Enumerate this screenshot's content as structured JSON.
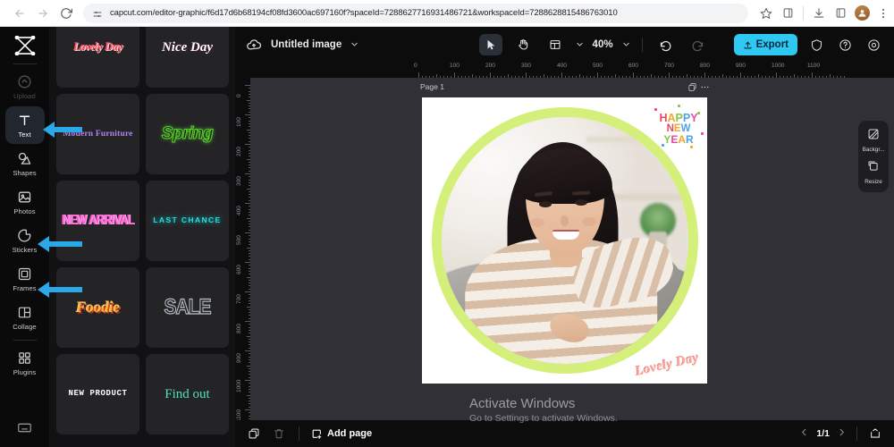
{
  "browser": {
    "back_icon": "back-arrow-icon",
    "forward_icon": "forward-arrow-icon",
    "reload_icon": "reload-icon",
    "url": "capcut.com/editor-graphic/f6d17d6b68194cf08fd3600ac697160f?spaceId=7288627716931486721&workspaceId=7288628815486763010",
    "bookmark_icon": "star-icon",
    "sidepanel_icon": "side-panel-icon",
    "download_icon": "download-icon",
    "extensions_icon": "extensions-icon",
    "profile_icon": "profile-avatar-icon",
    "menu_icon": "three-dot-menu-icon"
  },
  "rail": {
    "logo": "capcut-logo-icon",
    "items": [
      {
        "label": "Upload",
        "icon": "upload-icon",
        "state": "dim"
      },
      {
        "label": "Text",
        "icon": "text-icon",
        "state": "active"
      },
      {
        "label": "Shapes",
        "icon": "shapes-icon",
        "state": "normal"
      },
      {
        "label": "Photos",
        "icon": "photos-icon",
        "state": "normal"
      },
      {
        "label": "Stickers",
        "icon": "stickers-icon",
        "state": "normal"
      },
      {
        "label": "Frames",
        "icon": "frames-icon",
        "state": "normal"
      },
      {
        "label": "Collage",
        "icon": "collage-icon",
        "state": "normal"
      },
      {
        "label": "Plugins",
        "icon": "plugins-icon",
        "state": "normal"
      }
    ],
    "bottom_icon": "keyboard-icon"
  },
  "templates": [
    {
      "text": "Lovely Day",
      "style": "st-lovely"
    },
    {
      "text": "Nice Day",
      "style": "st-nice"
    },
    {
      "text": "Modern Furniture",
      "style": "st-modern"
    },
    {
      "text": "Spring",
      "style": "st-spring"
    },
    {
      "text": "NEW ARRIVAL",
      "style": "st-newarrival"
    },
    {
      "text": "LAST CHANCE",
      "style": "st-lastchance"
    },
    {
      "text": "Foodie",
      "style": "st-foodie"
    },
    {
      "text": "SALE",
      "style": "st-sale"
    },
    {
      "text": "NEW PRODUCT",
      "style": "st-newproduct"
    },
    {
      "text": "Find out",
      "style": "st-findout"
    }
  ],
  "topbar": {
    "cloud_icon": "cloud-save-icon",
    "doc_title": "Untitled image",
    "title_chevron": "chevron-down-icon",
    "select_tool_icon": "cursor-select-icon",
    "hand_tool_icon": "hand-pan-icon",
    "layout_tool_icon": "layout-icon",
    "layout_chevron": "chevron-down-icon",
    "zoom_value": "40%",
    "zoom_chevron": "chevron-down-icon",
    "undo_icon": "undo-icon",
    "redo_icon": "redo-icon",
    "export_label": "Export",
    "export_icon": "export-upload-icon",
    "export_color": "#2ec8f0",
    "shield_icon": "shield-icon",
    "help_icon": "help-circle-icon",
    "settings_icon": "settings-gear-icon"
  },
  "ruler": {
    "horizontal_ticks": [
      "0",
      "100",
      "200",
      "300",
      "400",
      "500",
      "600",
      "700",
      "800",
      "900",
      "1000",
      "1100"
    ],
    "vertical_ticks": [
      "0",
      "100",
      "200",
      "300",
      "400",
      "500",
      "600",
      "700",
      "800",
      "900",
      "1000",
      "1100"
    ]
  },
  "canvas": {
    "page_label": "Page 1",
    "duplicate_icon": "duplicate-page-icon",
    "more_icon": "more-options-icon",
    "background_color": "#ffffff",
    "circle_color": "#d4f07a",
    "sticker_new_year": {
      "line1": "HAPPY",
      "line2": "NEW",
      "line3": "YEAR"
    },
    "stamp_text": "Lovely Day",
    "stamp_color": "#f7a9a0"
  },
  "right_panel": {
    "items": [
      {
        "label": "Backgr...",
        "icon": "background-icon"
      },
      {
        "label": "Resize",
        "icon": "resize-icon"
      }
    ]
  },
  "bottom": {
    "duplicate_icon": "duplicate-icon",
    "delete_icon": "trash-icon",
    "add_page_label": "Add page",
    "add_page_icon": "add-page-icon",
    "prev_icon": "chevron-left-icon",
    "page_indicator": "1/1",
    "next_icon": "chevron-right-icon",
    "fullscreen_icon": "present-icon"
  },
  "watermark": {
    "title": "Activate Windows",
    "subtitle": "Go to Settings to activate Windows."
  },
  "annotations": {
    "arrow_color": "#2aa8e8",
    "arrows": [
      {
        "target": "Text"
      },
      {
        "target": "Stickers"
      },
      {
        "target": "Frames"
      }
    ]
  }
}
